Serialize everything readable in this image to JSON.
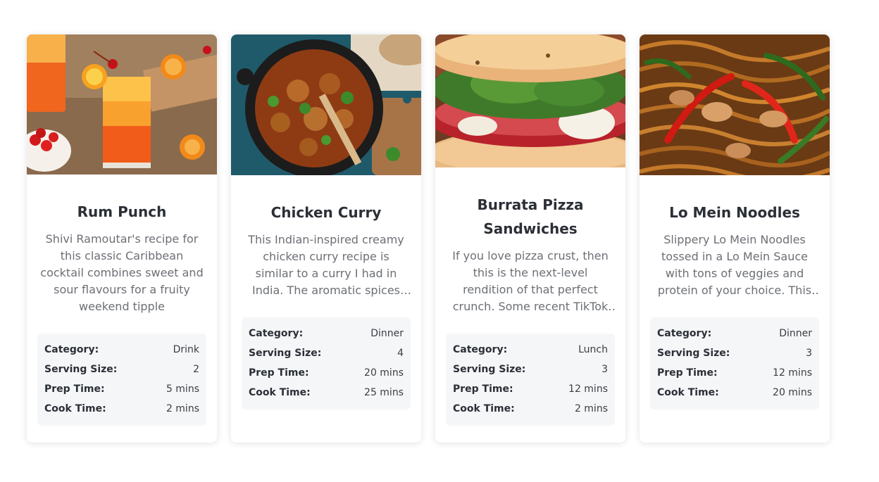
{
  "labels": {
    "category": "Category:",
    "serving_size": "Serving Size:",
    "prep_time": "Prep Time:",
    "cook_time": "Cook Time:"
  },
  "recipes": [
    {
      "title": "Rum Punch",
      "image": "rum-punch-photo",
      "description": "Shivi Ramoutar's recipe for this classic Caribbean cocktail combines sweet and sour flavours for a fruity weekend tipple",
      "category": "Drink",
      "serving_size": "2",
      "prep_time": "5 mins",
      "cook_time": "2 mins"
    },
    {
      "title": "Chicken Curry",
      "image": "chicken-curry-photo",
      "description": "This Indian-inspired creamy chicken curry recipe is similar to a curry I had in India. The aromatic spices and flavors ...",
      "category": "Dinner",
      "serving_size": "4",
      "prep_time": "20 mins",
      "cook_time": "25 mins"
    },
    {
      "title": "Burrata Pizza Sandwiches",
      "image": "burrata-sandwich-photo",
      "description": "If you love pizza crust, then this is the next-level rendition of that perfect crunch. Some recent TikTok scrolling led ...",
      "category": "Lunch",
      "serving_size": "3",
      "prep_time": "12 mins",
      "cook_time": "2 mins"
    },
    {
      "title": "Lo Mein Noodles",
      "image": "lo-mein-photo",
      "description": "Slippery Lo Mein Noodles tossed in a Lo Mein Sauce with tons of veggies and protein of your choice. This ...",
      "category": "Dinner",
      "serving_size": "3",
      "prep_time": "12 mins",
      "cook_time": "20 mins"
    }
  ]
}
